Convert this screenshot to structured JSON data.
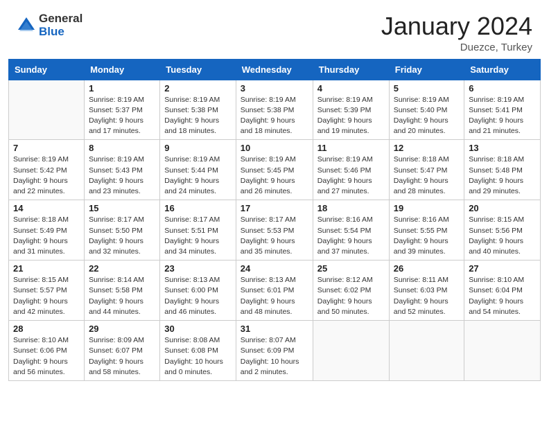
{
  "header": {
    "logo_general": "General",
    "logo_blue": "Blue",
    "month_title": "January 2024",
    "location": "Duezce, Turkey"
  },
  "days_of_week": [
    "Sunday",
    "Monday",
    "Tuesday",
    "Wednesday",
    "Thursday",
    "Friday",
    "Saturday"
  ],
  "weeks": [
    [
      {
        "day": "",
        "info": ""
      },
      {
        "day": "1",
        "info": "Sunrise: 8:19 AM\nSunset: 5:37 PM\nDaylight: 9 hours\nand 17 minutes."
      },
      {
        "day": "2",
        "info": "Sunrise: 8:19 AM\nSunset: 5:38 PM\nDaylight: 9 hours\nand 18 minutes."
      },
      {
        "day": "3",
        "info": "Sunrise: 8:19 AM\nSunset: 5:38 PM\nDaylight: 9 hours\nand 18 minutes."
      },
      {
        "day": "4",
        "info": "Sunrise: 8:19 AM\nSunset: 5:39 PM\nDaylight: 9 hours\nand 19 minutes."
      },
      {
        "day": "5",
        "info": "Sunrise: 8:19 AM\nSunset: 5:40 PM\nDaylight: 9 hours\nand 20 minutes."
      },
      {
        "day": "6",
        "info": "Sunrise: 8:19 AM\nSunset: 5:41 PM\nDaylight: 9 hours\nand 21 minutes."
      }
    ],
    [
      {
        "day": "7",
        "info": "Sunrise: 8:19 AM\nSunset: 5:42 PM\nDaylight: 9 hours\nand 22 minutes."
      },
      {
        "day": "8",
        "info": "Sunrise: 8:19 AM\nSunset: 5:43 PM\nDaylight: 9 hours\nand 23 minutes."
      },
      {
        "day": "9",
        "info": "Sunrise: 8:19 AM\nSunset: 5:44 PM\nDaylight: 9 hours\nand 24 minutes."
      },
      {
        "day": "10",
        "info": "Sunrise: 8:19 AM\nSunset: 5:45 PM\nDaylight: 9 hours\nand 26 minutes."
      },
      {
        "day": "11",
        "info": "Sunrise: 8:19 AM\nSunset: 5:46 PM\nDaylight: 9 hours\nand 27 minutes."
      },
      {
        "day": "12",
        "info": "Sunrise: 8:18 AM\nSunset: 5:47 PM\nDaylight: 9 hours\nand 28 minutes."
      },
      {
        "day": "13",
        "info": "Sunrise: 8:18 AM\nSunset: 5:48 PM\nDaylight: 9 hours\nand 29 minutes."
      }
    ],
    [
      {
        "day": "14",
        "info": "Sunrise: 8:18 AM\nSunset: 5:49 PM\nDaylight: 9 hours\nand 31 minutes."
      },
      {
        "day": "15",
        "info": "Sunrise: 8:17 AM\nSunset: 5:50 PM\nDaylight: 9 hours\nand 32 minutes."
      },
      {
        "day": "16",
        "info": "Sunrise: 8:17 AM\nSunset: 5:51 PM\nDaylight: 9 hours\nand 34 minutes."
      },
      {
        "day": "17",
        "info": "Sunrise: 8:17 AM\nSunset: 5:53 PM\nDaylight: 9 hours\nand 35 minutes."
      },
      {
        "day": "18",
        "info": "Sunrise: 8:16 AM\nSunset: 5:54 PM\nDaylight: 9 hours\nand 37 minutes."
      },
      {
        "day": "19",
        "info": "Sunrise: 8:16 AM\nSunset: 5:55 PM\nDaylight: 9 hours\nand 39 minutes."
      },
      {
        "day": "20",
        "info": "Sunrise: 8:15 AM\nSunset: 5:56 PM\nDaylight: 9 hours\nand 40 minutes."
      }
    ],
    [
      {
        "day": "21",
        "info": "Sunrise: 8:15 AM\nSunset: 5:57 PM\nDaylight: 9 hours\nand 42 minutes."
      },
      {
        "day": "22",
        "info": "Sunrise: 8:14 AM\nSunset: 5:58 PM\nDaylight: 9 hours\nand 44 minutes."
      },
      {
        "day": "23",
        "info": "Sunrise: 8:13 AM\nSunset: 6:00 PM\nDaylight: 9 hours\nand 46 minutes."
      },
      {
        "day": "24",
        "info": "Sunrise: 8:13 AM\nSunset: 6:01 PM\nDaylight: 9 hours\nand 48 minutes."
      },
      {
        "day": "25",
        "info": "Sunrise: 8:12 AM\nSunset: 6:02 PM\nDaylight: 9 hours\nand 50 minutes."
      },
      {
        "day": "26",
        "info": "Sunrise: 8:11 AM\nSunset: 6:03 PM\nDaylight: 9 hours\nand 52 minutes."
      },
      {
        "day": "27",
        "info": "Sunrise: 8:10 AM\nSunset: 6:04 PM\nDaylight: 9 hours\nand 54 minutes."
      }
    ],
    [
      {
        "day": "28",
        "info": "Sunrise: 8:10 AM\nSunset: 6:06 PM\nDaylight: 9 hours\nand 56 minutes."
      },
      {
        "day": "29",
        "info": "Sunrise: 8:09 AM\nSunset: 6:07 PM\nDaylight: 9 hours\nand 58 minutes."
      },
      {
        "day": "30",
        "info": "Sunrise: 8:08 AM\nSunset: 6:08 PM\nDaylight: 10 hours\nand 0 minutes."
      },
      {
        "day": "31",
        "info": "Sunrise: 8:07 AM\nSunset: 6:09 PM\nDaylight: 10 hours\nand 2 minutes."
      },
      {
        "day": "",
        "info": ""
      },
      {
        "day": "",
        "info": ""
      },
      {
        "day": "",
        "info": ""
      }
    ]
  ]
}
